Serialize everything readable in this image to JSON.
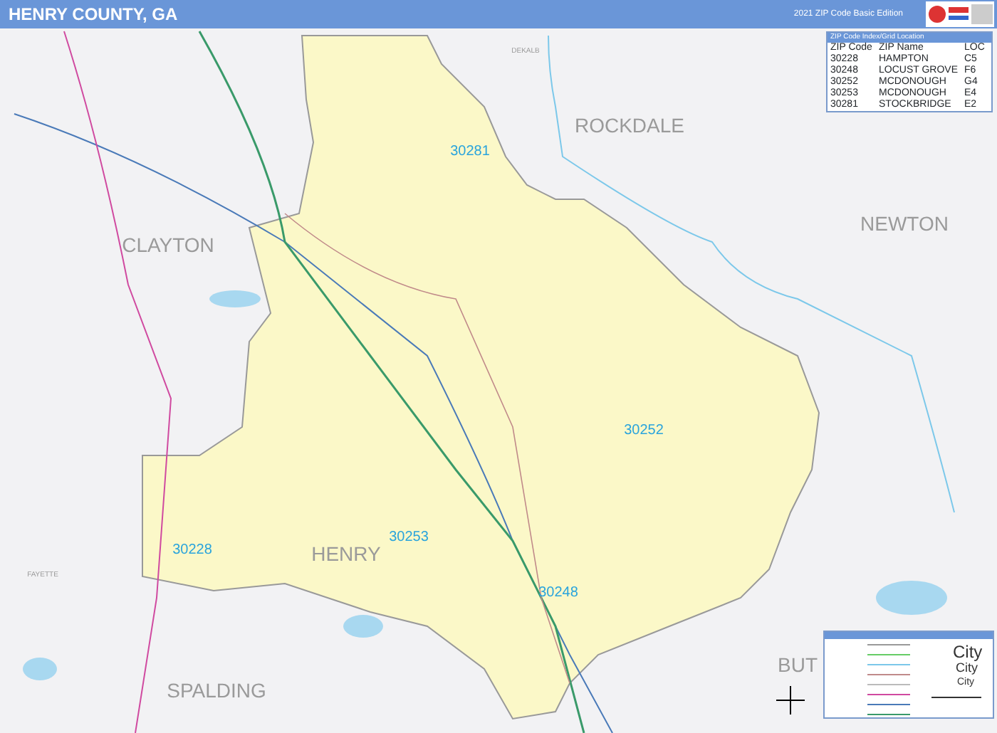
{
  "header": {
    "title": "HENRY COUNTY, GA",
    "edition": "2021 ZIP Code Basic Edition"
  },
  "map": {
    "counties": [
      {
        "name": "DEKALB",
        "kind": "minor"
      },
      {
        "name": "ROCKDALE",
        "kind": "major"
      },
      {
        "name": "CLAYTON",
        "kind": "major"
      },
      {
        "name": "NEWTON",
        "kind": "major"
      },
      {
        "name": "FAYETTE",
        "kind": "minor"
      },
      {
        "name": "HENRY",
        "kind": "major"
      },
      {
        "name": "SPALDING",
        "kind": "major"
      },
      {
        "name": "BUT",
        "kind": "major"
      }
    ],
    "zip_labels": [
      "30281",
      "30252",
      "30253",
      "30248",
      "30228"
    ]
  },
  "zip_index": {
    "title": "ZIP Code Index/Grid Location",
    "columns": [
      "ZIP Code",
      "ZIP Name",
      "LOC"
    ],
    "rows": [
      [
        "30228",
        "HAMPTON",
        "C5"
      ],
      [
        "30248",
        "LOCUST GROVE",
        "F6"
      ],
      [
        "30252",
        "MCDONOUGH",
        "G4"
      ],
      [
        "30253",
        "MCDONOUGH",
        "E4"
      ],
      [
        "30281",
        "STOCKBRIDGE",
        "E2"
      ]
    ]
  },
  "legend": {
    "city_samples": [
      "City",
      "City",
      "City"
    ]
  }
}
